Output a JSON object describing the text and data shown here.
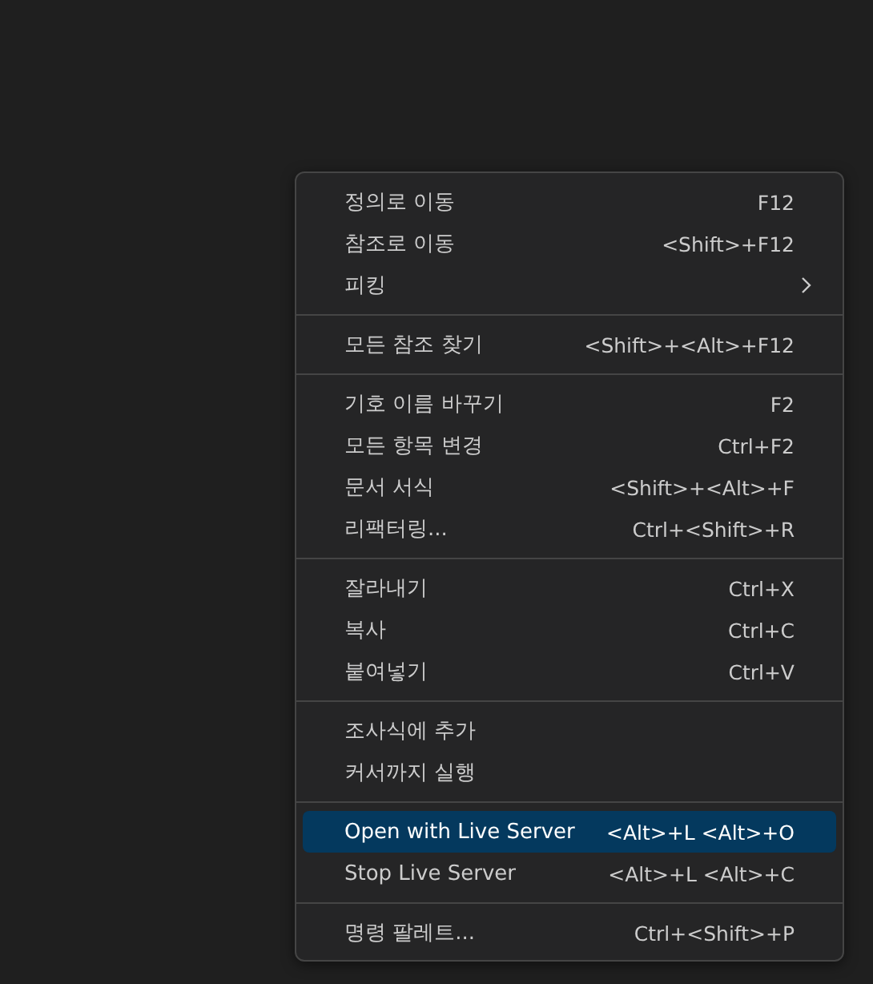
{
  "context_menu": {
    "groups": [
      {
        "items": [
          {
            "label": "정의로 이동",
            "shortcut": "F12",
            "submenu": false,
            "selected": false
          },
          {
            "label": "참조로 이동",
            "shortcut": "<Shift>+F12",
            "submenu": false,
            "selected": false
          },
          {
            "label": "피킹",
            "submenu": true,
            "selected": false
          }
        ]
      },
      {
        "items": [
          {
            "label": "모든 참조 찾기",
            "shortcut": "<Shift>+<Alt>+F12",
            "submenu": false,
            "selected": false
          }
        ]
      },
      {
        "items": [
          {
            "label": "기호 이름 바꾸기",
            "shortcut": "F2",
            "submenu": false,
            "selected": false
          },
          {
            "label": "모든 항목 변경",
            "shortcut": "Ctrl+F2",
            "submenu": false,
            "selected": false
          },
          {
            "label": "문서 서식",
            "shortcut": "<Shift>+<Alt>+F",
            "submenu": false,
            "selected": false
          },
          {
            "label": "리팩터링...",
            "shortcut": "Ctrl+<Shift>+R",
            "submenu": false,
            "selected": false
          }
        ]
      },
      {
        "items": [
          {
            "label": "잘라내기",
            "shortcut": "Ctrl+X",
            "submenu": false,
            "selected": false
          },
          {
            "label": "복사",
            "shortcut": "Ctrl+C",
            "submenu": false,
            "selected": false
          },
          {
            "label": "붙여넣기",
            "shortcut": "Ctrl+V",
            "submenu": false,
            "selected": false
          }
        ]
      },
      {
        "items": [
          {
            "label": "조사식에 추가",
            "submenu": false,
            "selected": false
          },
          {
            "label": "커서까지 실행",
            "submenu": false,
            "selected": false
          }
        ]
      },
      {
        "items": [
          {
            "label": "Open with Live Server",
            "shortcut": "<Alt>+L <Alt>+O",
            "submenu": false,
            "selected": true
          },
          {
            "label": "Stop Live Server",
            "shortcut": "<Alt>+L <Alt>+C",
            "submenu": false,
            "selected": false
          }
        ]
      },
      {
        "items": [
          {
            "label": "명령 팔레트...",
            "shortcut": "Ctrl+<Shift>+P",
            "submenu": false,
            "selected": false
          }
        ]
      }
    ]
  }
}
